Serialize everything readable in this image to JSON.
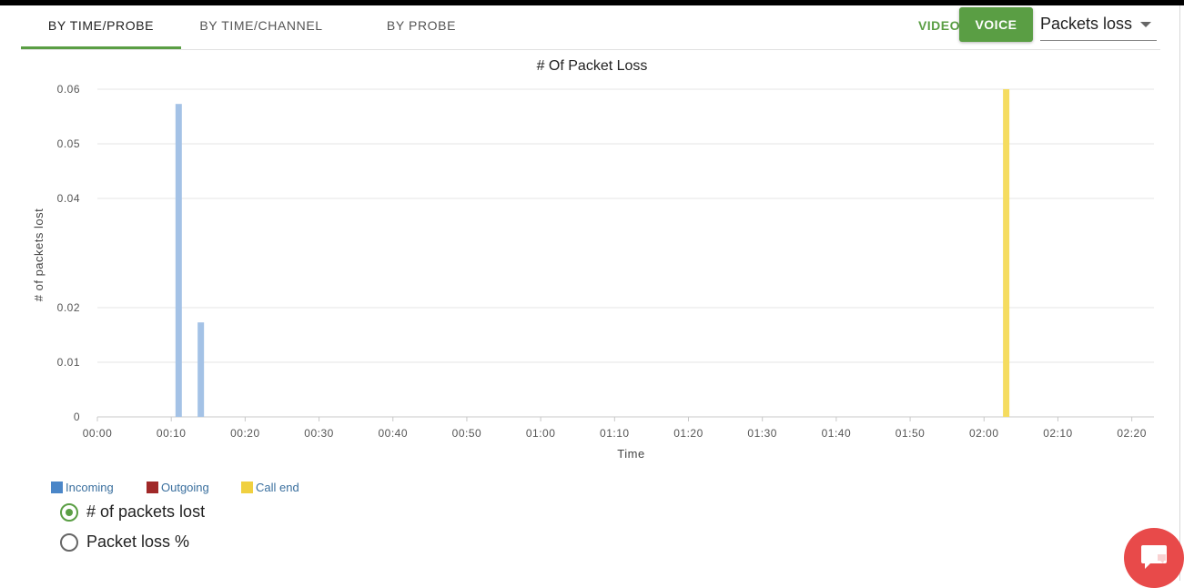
{
  "tabs": [
    {
      "label": "BY TIME/PROBE",
      "active": true
    },
    {
      "label": "BY TIME/CHANNEL",
      "active": false
    },
    {
      "label": "BY PROBE",
      "active": false
    }
  ],
  "toolbar": {
    "video_label": "VIDEO",
    "voice_label": "VOICE",
    "metric_select_value": "Packets loss"
  },
  "colors": {
    "accent_green": "#5a9e44",
    "incoming": "#4a86c8",
    "incoming_bar": "#a4c2e6",
    "outgoing": "#a02828",
    "call_end": "#f0d040",
    "call_end_bar": "#f5dc60",
    "chat_button": "#e84a4a"
  },
  "chart_data": {
    "type": "bar",
    "title": "# Of Packet Loss",
    "xlabel": "Time",
    "ylabel": "# of packets lost",
    "x_ticks": [
      "00:00",
      "00:10",
      "00:20",
      "00:30",
      "00:40",
      "00:50",
      "01:00",
      "01:10",
      "01:20",
      "01:30",
      "01:40",
      "01:50",
      "02:00",
      "02:10",
      "02:20"
    ],
    "y_ticks": [
      "0",
      "0.01",
      "0.02",
      "0.04",
      "0.05",
      "0.06"
    ],
    "y_tick_values": [
      0,
      0.01,
      0.02,
      0.04,
      0.05,
      0.06
    ],
    "ylim": [
      0,
      0.06
    ],
    "xlim_minutes": [
      0,
      143
    ],
    "grid": true,
    "legend_placement": "bottom-left",
    "series": [
      {
        "name": "Incoming",
        "color": "#4a86c8",
        "bar_color": "#a4c2e6",
        "points": [
          {
            "x": "00:11",
            "y": 0.0573
          },
          {
            "x": "00:14",
            "y": 0.0173
          }
        ]
      },
      {
        "name": "Outgoing",
        "color": "#a02828",
        "bar_color": "#a02828",
        "points": []
      },
      {
        "name": "Call end",
        "color": "#f0d040",
        "bar_color": "#f5dc60",
        "points": [
          {
            "x": "02:03",
            "y": 0.06
          }
        ]
      }
    ]
  },
  "display_mode": {
    "options": [
      {
        "label": "# of packets lost",
        "selected": true
      },
      {
        "label": "Packet loss %",
        "selected": false
      }
    ]
  },
  "chat": {
    "icon": "chat-bubble-icon"
  }
}
